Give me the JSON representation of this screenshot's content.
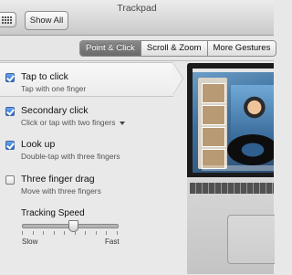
{
  "window": {
    "title": "Trackpad"
  },
  "toolbar": {
    "show_all_label": "Show All"
  },
  "tabs": [
    {
      "label": "Point & Click",
      "active": true
    },
    {
      "label": "Scroll & Zoom",
      "active": false
    },
    {
      "label": "More Gestures",
      "active": false
    }
  ],
  "options": [
    {
      "title": "Tap to click",
      "subtitle": "Tap with one finger",
      "checked": true,
      "selected": true
    },
    {
      "title": "Secondary click",
      "subtitle": "Click or tap with two fingers",
      "checked": true,
      "has_dropdown": true
    },
    {
      "title": "Look up",
      "subtitle": "Double-tap with three fingers",
      "checked": true
    },
    {
      "title": "Three finger drag",
      "subtitle": "Move with three fingers",
      "checked": false
    }
  ],
  "tracking": {
    "label": "Tracking Speed",
    "min_label": "Slow",
    "max_label": "Fast",
    "value_fraction": 0.53,
    "tick_count": 10
  },
  "colors": {
    "accent": "#2b6fcf",
    "active_tab": "#7a7a7a"
  },
  "icons": {
    "grid": "grid-icon",
    "dropdown": "chevron-down-icon"
  }
}
